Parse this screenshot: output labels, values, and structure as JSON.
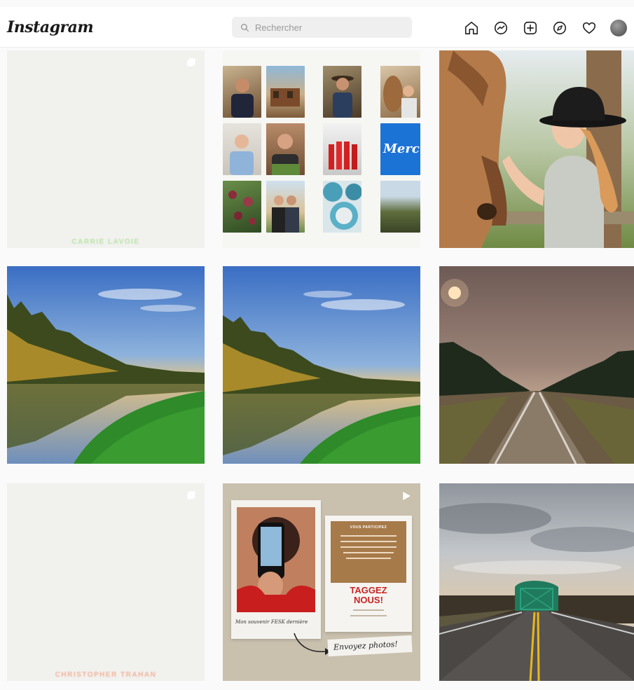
{
  "app": {
    "logo_text": "Instagram"
  },
  "search": {
    "placeholder": "Rechercher"
  },
  "nav": {
    "icons": [
      "home-icon",
      "messenger-icon",
      "new-post-icon",
      "explore-icon",
      "activity-heart-icon",
      "profile-avatar"
    ]
  },
  "grid": {
    "posts": [
      {
        "name": "post-tile-1",
        "caption": "CARRIE LAVOIE",
        "caption_color": "#b9e3a6"
      },
      {
        "name": "post-tile-2",
        "image": "photo-collage-mosaic"
      },
      {
        "name": "post-tile-3",
        "image": "girl-with-horse-cowboy-hat"
      },
      {
        "name": "post-tile-4",
        "image": "forest-lake-sunset"
      },
      {
        "name": "post-tile-5",
        "image": "forest-lake-sunset"
      },
      {
        "name": "post-tile-6",
        "image": "railway-tracks-smoky-sun"
      },
      {
        "name": "post-tile-7",
        "caption": "CHRISTOPHER TRAHAN",
        "caption_color": "#f2b39c"
      },
      {
        "name": "post-tile-8",
        "image": "tag-us-polaroid-promo"
      },
      {
        "name": "post-tile-9",
        "image": "highway-green-bridge"
      }
    ]
  },
  "promo": {
    "header": "VOUS PARTICIPEZ",
    "headline_1": "TAGGEZ",
    "headline_2": "NOUS!",
    "caption_left": "Mon souvenir FESK dernière",
    "caption_right": "Envoyez photos!"
  },
  "collage": {
    "brand_snippet": "Merc"
  },
  "colors": {
    "accent_blue": "#1c73d6",
    "tile_blank": "#f1f1ee",
    "brand_kraft": "#a77a4a"
  }
}
